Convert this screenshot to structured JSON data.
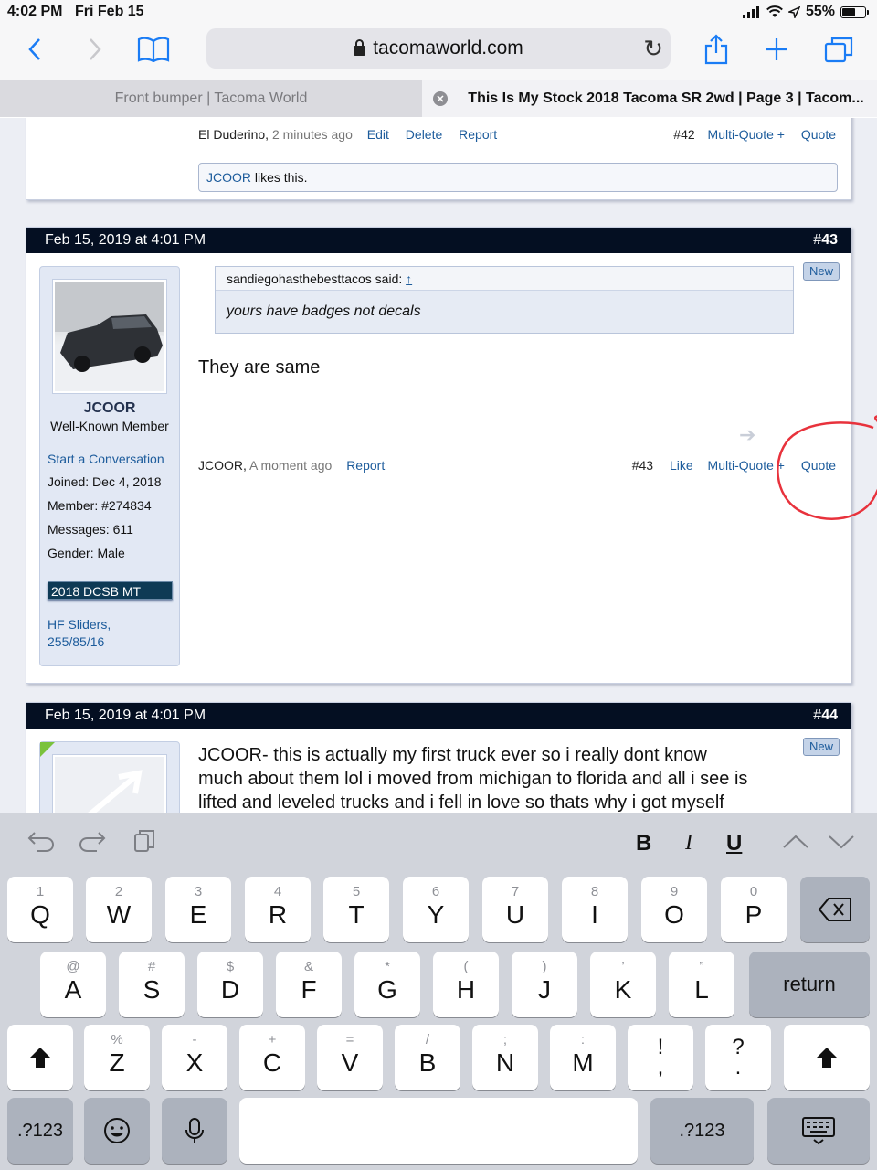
{
  "status": {
    "time": "4:02 PM",
    "date": "Fri Feb 15",
    "battery": "55%"
  },
  "browser": {
    "url": "tacomaworld.com"
  },
  "tabs": [
    {
      "label": "Front bumper | Tacoma World",
      "active": false
    },
    {
      "label": "This Is My Stock 2018 Tacoma SR 2wd | Page 3 | Tacom...",
      "active": true
    }
  ],
  "post42": {
    "author": "El Duderino,",
    "time": "2 minutes ago",
    "edit": "Edit",
    "delete": "Delete",
    "report": "Report",
    "number": "#42",
    "multiquote": "Multi-Quote +",
    "quote": "Quote",
    "likes_user": "JCOOR",
    "likes_text": "likes this."
  },
  "post43": {
    "date": "Feb 15, 2019 at 4:01 PM",
    "hash": "#",
    "num": "43",
    "new_badge": "New",
    "user": {
      "name": "JCOOR",
      "title": "Well-Known Member",
      "start_conversation": "Start a Conversation",
      "joined_label": "Joined:",
      "joined": "Dec 4, 2018",
      "member_label": "Member:",
      "member": "#274834",
      "messages_label": "Messages:",
      "messages": "611",
      "gender_label": "Gender:",
      "gender": "Male",
      "badge": "2018 DCSB MT",
      "sig_line1": "HF Sliders,",
      "sig_line2": "255/85/16"
    },
    "quote": {
      "author": "sandiegohasthebesttacos said:",
      "arrow": "↑",
      "text": "yours have badges not decals"
    },
    "text": "They are same",
    "footer": {
      "author": "JCOOR,",
      "time": "A moment ago",
      "report": "Report",
      "number": "#43",
      "like": "Like",
      "multiquote": "Multi-Quote +",
      "quote": "Quote"
    }
  },
  "post44": {
    "date": "Feb 15, 2019 at 4:01 PM",
    "hash": "#",
    "num": "44",
    "new_badge": "New",
    "text_line1": "JCOOR- this is actually my first truck ever so i really dont know",
    "text_line2": "much about them lol i moved from michigan to florida and all i see is",
    "text_line3": "lifted and leveled trucks and i fell in love so thats why i got myself"
  },
  "keyboard": {
    "format": {
      "bold": "B",
      "italic": "I",
      "underline": "U"
    },
    "row1": [
      {
        "hint": "1",
        "key": "Q"
      },
      {
        "hint": "2",
        "key": "W"
      },
      {
        "hint": "3",
        "key": "E"
      },
      {
        "hint": "4",
        "key": "R"
      },
      {
        "hint": "5",
        "key": "T"
      },
      {
        "hint": "6",
        "key": "Y"
      },
      {
        "hint": "7",
        "key": "U"
      },
      {
        "hint": "8",
        "key": "I"
      },
      {
        "hint": "9",
        "key": "O"
      },
      {
        "hint": "0",
        "key": "P"
      }
    ],
    "row2": [
      {
        "hint": "@",
        "key": "A"
      },
      {
        "hint": "#",
        "key": "S"
      },
      {
        "hint": "$",
        "key": "D"
      },
      {
        "hint": "&",
        "key": "F"
      },
      {
        "hint": "*",
        "key": "G"
      },
      {
        "hint": "(",
        "key": "H"
      },
      {
        "hint": ")",
        "key": "J"
      },
      {
        "hint": "’",
        "key": "K"
      },
      {
        "hint": "”",
        "key": "L"
      }
    ],
    "return": "return",
    "row3": [
      {
        "hint": "%",
        "key": "Z"
      },
      {
        "hint": "-",
        "key": "X"
      },
      {
        "hint": "+",
        "key": "C"
      },
      {
        "hint": "=",
        "key": "V"
      },
      {
        "hint": "/",
        "key": "B"
      },
      {
        "hint": ";",
        "key": "N"
      },
      {
        "hint": ":",
        "key": "M"
      }
    ],
    "punct1_top": "!",
    "punct1_bottom": ",",
    "punct2_top": "?",
    "punct2_bottom": ".",
    "numbers": ".?123"
  }
}
